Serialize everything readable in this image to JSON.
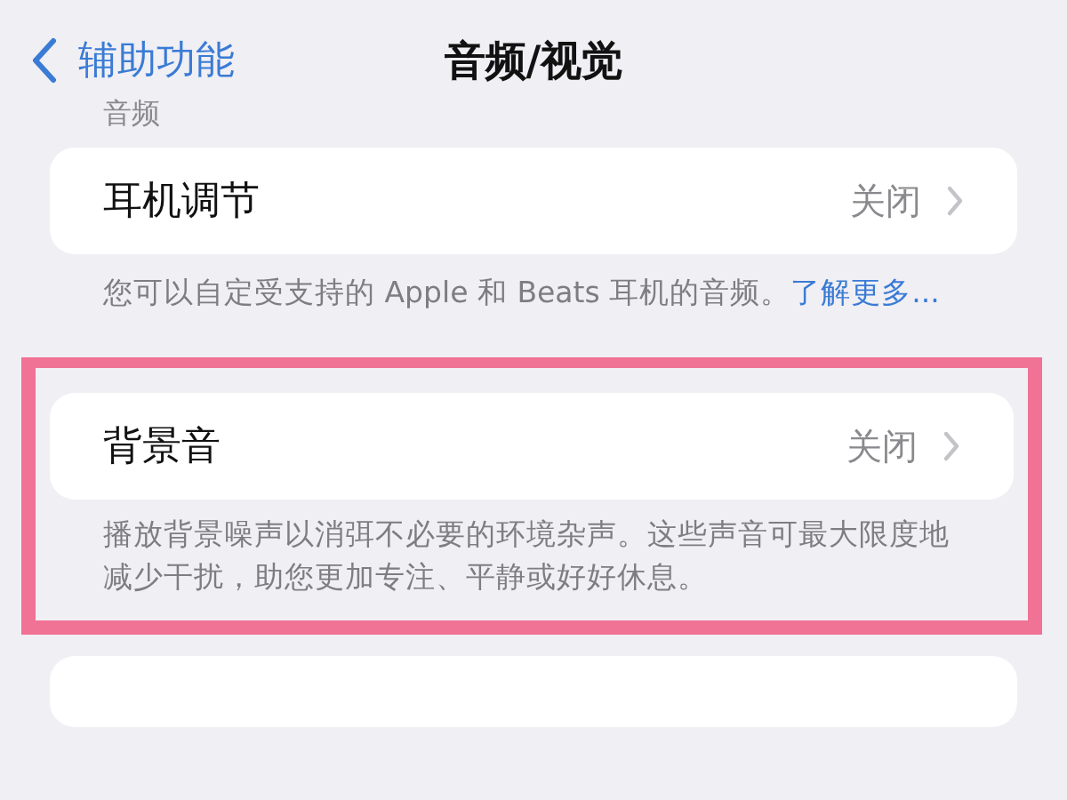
{
  "nav": {
    "back_label": "辅助功能",
    "title": "音频/视觉"
  },
  "sections": [
    {
      "header": "音频",
      "rows": [
        {
          "label": "耳机调节",
          "value": "关闭"
        }
      ],
      "footer": "您可以自定受支持的 Apple 和 Beats 耳机的音频。",
      "footer_link": "了解更多...",
      "highlighted": false
    },
    {
      "rows": [
        {
          "label": "背景音",
          "value": "关闭"
        }
      ],
      "footer": "播放背景噪声以消弭不必要的环境杂声。这些声音可最大限度地减少干扰，助您更加专注、平静或好好休息。",
      "highlighted": true
    }
  ]
}
